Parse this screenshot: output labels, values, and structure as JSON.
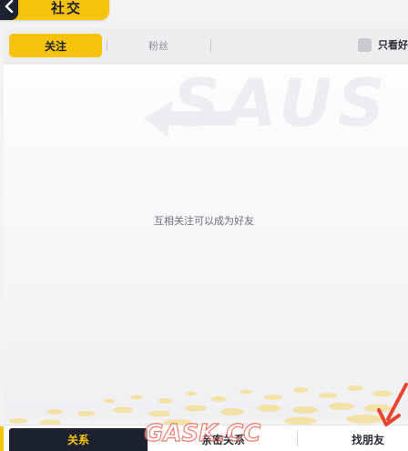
{
  "header": {
    "title": "社交",
    "back_icon": "chevron-left-icon"
  },
  "tabs": [
    {
      "label": "关注",
      "active": true
    },
    {
      "label": "粉丝",
      "active": false
    }
  ],
  "filter": {
    "label": "只看好",
    "checked": false
  },
  "watermark_text": "SAUS",
  "empty_hint": "互相关注可以成为好友",
  "bottom_nav": {
    "relation_label": "关系",
    "bond_label": "亲密关系",
    "find_friends_label": "找朋友"
  },
  "site_mark": "GASK.CC",
  "colors": {
    "accent": "#f7c20a",
    "dark": "#1d2231",
    "arrow": "#e8432e"
  }
}
